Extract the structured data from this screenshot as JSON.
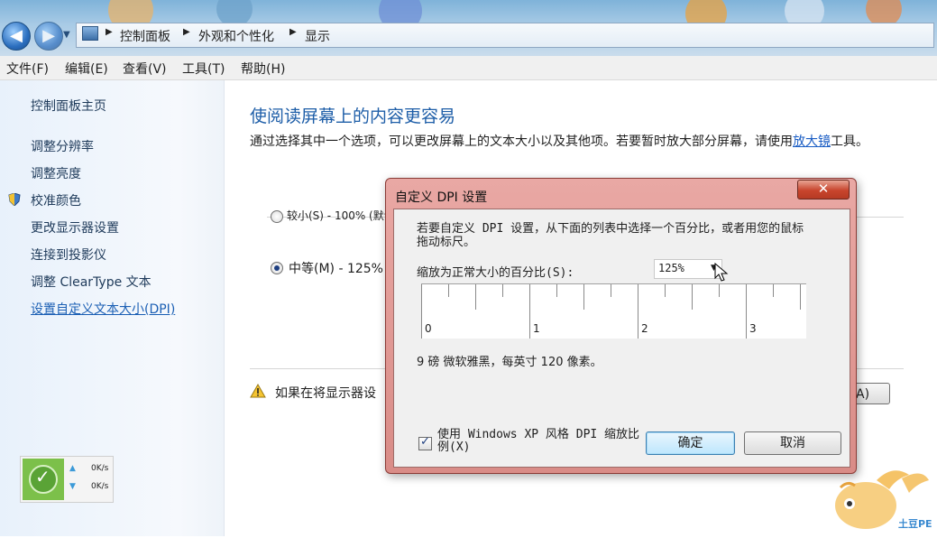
{
  "addressbar": {
    "crumbs": [
      "控制面板",
      "外观和个性化",
      "显示"
    ]
  },
  "menubar": {
    "items": [
      "文件(F)",
      "编辑(E)",
      "查看(V)",
      "工具(T)",
      "帮助(H)"
    ]
  },
  "sidebar": {
    "home": "控制面板主页",
    "items": [
      {
        "label": "调整分辨率"
      },
      {
        "label": "调整亮度"
      },
      {
        "label": "校准颜色"
      },
      {
        "label": "更改显示器设置"
      },
      {
        "label": "连接到投影仪"
      },
      {
        "label": "调整 ClearType 文本"
      },
      {
        "label": "设置自定义文本大小(DPI)"
      }
    ]
  },
  "main": {
    "title": "使阅读屏幕上的内容更容易",
    "desc_before": "通过选择其中一个选项，可以更改屏幕上的文本大小以及其他项。若要暂时放大部分屏幕，请使用",
    "desc_link": "放大镜",
    "desc_after": "工具。",
    "option_small": "较小(S) - 100% (默认",
    "option_medium": "中等(M) - 125%",
    "warning_text": "如果在将显示器设",
    "apply_partial": "A)"
  },
  "net_widget": {
    "up": "0K/s",
    "down": "0K/s"
  },
  "dialog": {
    "title": "自定义 DPI 设置",
    "close_glyph": "✕",
    "instruction": "若要自定义 DPI 设置，从下面的列表中选择一个百分比，或者用您的鼠标拖动标尺。",
    "scale_label": "缩放为正常大小的百分比(S):",
    "scale_value": "125%",
    "ruler_labels": [
      "0",
      "1",
      "2",
      "3"
    ],
    "sample_text": "9 磅 微软雅黑，每英寸 120 像素。",
    "checkbox_label": "使用 Windows XP 风格 DPI 缩放比例(X)",
    "checkbox_checked": true,
    "ok_label": "确定",
    "cancel_label": "取消"
  },
  "watermark": {
    "text": "土豆PE"
  }
}
